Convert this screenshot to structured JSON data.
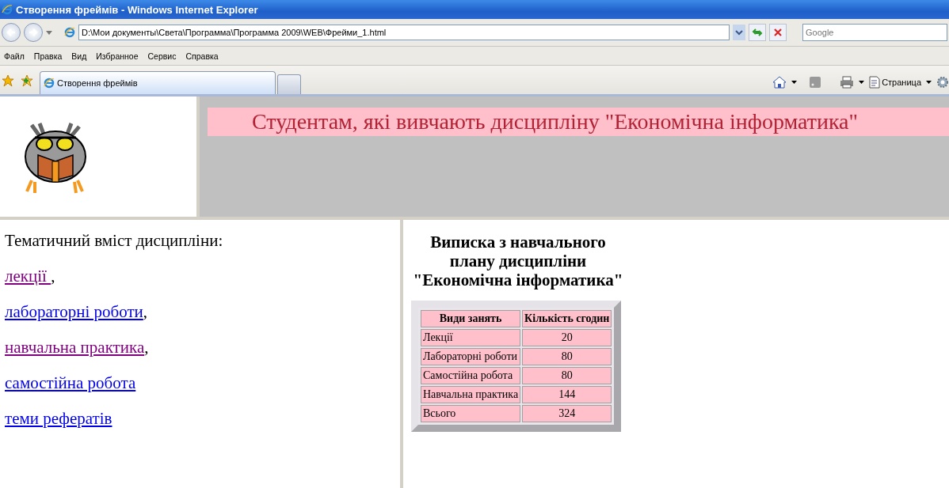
{
  "window": {
    "title": "Створення фреймів - Windows Internet Explorer"
  },
  "address": {
    "value": "D:\\Мои документы\\Света\\Программа\\Программа 2009\\WEB\\Фрейми_1.html"
  },
  "search": {
    "placeholder": "Google"
  },
  "menu": [
    "Файл",
    "Правка",
    "Вид",
    "Избранное",
    "Сервис",
    "Справка"
  ],
  "tabs": [
    {
      "label": "Створення фреймів",
      "selected": true
    }
  ],
  "command_bar": {
    "page_label": "Страница"
  },
  "banner": {
    "text": "Студентам, які вивчають дисципліну \"Економічна інформатика\""
  },
  "nav": {
    "heading": "Тематичний вміст дисципліни:",
    "links": [
      {
        "label": "лекції ",
        "suffix": ",",
        "visited": true
      },
      {
        "label": "лабораторні роботи",
        "suffix": ",",
        "visited": false
      },
      {
        "label": "навчальна практика",
        "suffix": ",",
        "visited": true
      },
      {
        "label": "самостійна робота",
        "visited": false
      },
      {
        "label": "теми рефератів",
        "visited": false
      }
    ]
  },
  "content": {
    "heading": "Виписка з навчального плану дисципліни \"Економічна інформатика\"",
    "columns": [
      "Види занять",
      "Кількість сгодин"
    ],
    "rows": [
      [
        "Лекції",
        "20"
      ],
      [
        "Лабораторні роботи",
        "80"
      ],
      [
        "Самостійна робота",
        "80"
      ],
      [
        "Навчальна практика",
        "144"
      ],
      [
        "Всього",
        "324"
      ]
    ]
  }
}
